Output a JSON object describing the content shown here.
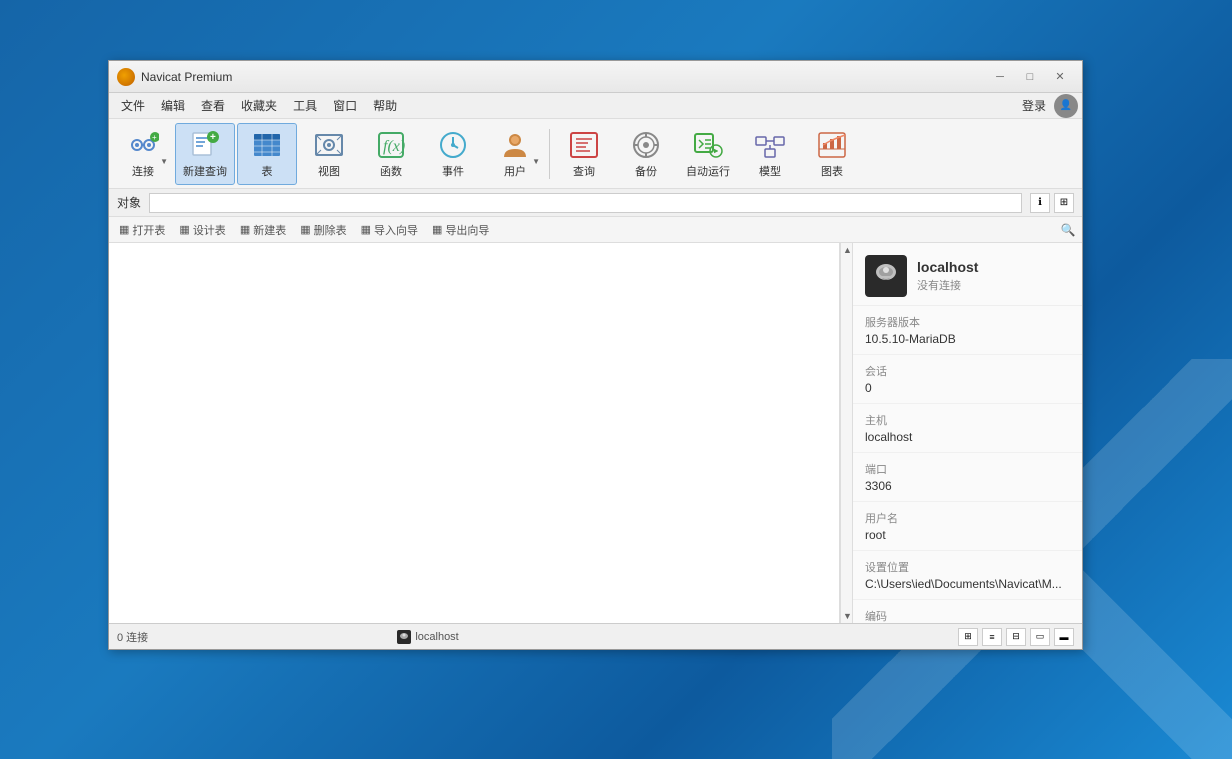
{
  "desktop": {
    "bg_color": "#1565a8"
  },
  "window": {
    "title": "Navicat Premium",
    "title_bar": {
      "app_name": "Navicat Premium",
      "minimize": "─",
      "restore": "□",
      "close": "✕"
    },
    "menu": {
      "items": [
        "文件",
        "编辑",
        "查看",
        "收藏夹",
        "工具",
        "窗口",
        "帮助"
      ],
      "login": "登录"
    },
    "toolbar": {
      "buttons": [
        {
          "id": "connect",
          "label": "连接",
          "has_arrow": true
        },
        {
          "id": "new-query",
          "label": "新建查询",
          "active": true
        },
        {
          "id": "table",
          "label": "表"
        },
        {
          "id": "view",
          "label": "视图"
        },
        {
          "id": "function",
          "label": "函数"
        },
        {
          "id": "event",
          "label": "事件"
        },
        {
          "id": "user",
          "label": "用户",
          "has_arrow": true
        },
        {
          "id": "query",
          "label": "查询"
        },
        {
          "id": "backup",
          "label": "备份"
        },
        {
          "id": "auto-run",
          "label": "自动运行"
        },
        {
          "id": "model",
          "label": "模型"
        },
        {
          "id": "chart",
          "label": "图表"
        }
      ]
    },
    "object_bar": {
      "label": "对象",
      "search_placeholder": ""
    },
    "action_bar": {
      "buttons": [
        {
          "label": "打开表",
          "icon": "▦"
        },
        {
          "label": "设计表",
          "icon": "▦"
        },
        {
          "label": "新建表",
          "icon": "▦"
        },
        {
          "label": "删除表",
          "icon": "▦"
        },
        {
          "label": "导入向导",
          "icon": "▦"
        },
        {
          "label": "导出向导",
          "icon": "▦"
        }
      ]
    },
    "right_panel": {
      "server_name": "localhost",
      "connection_status": "没有连接",
      "server_version_label": "服务器版本",
      "server_version": "10.5.10-MariaDB",
      "session_label": "会话",
      "session": "0",
      "host_label": "主机",
      "host": "localhost",
      "port_label": "端口",
      "port": "3306",
      "username_label": "用户名",
      "username": "root",
      "settings_label": "设置位置",
      "settings_path": "C:\\Users\\ied\\Documents\\Navicat\\M...",
      "encoding_label": "编码"
    },
    "status_bar": {
      "connections": "0 连接",
      "server": "localhost"
    }
  }
}
